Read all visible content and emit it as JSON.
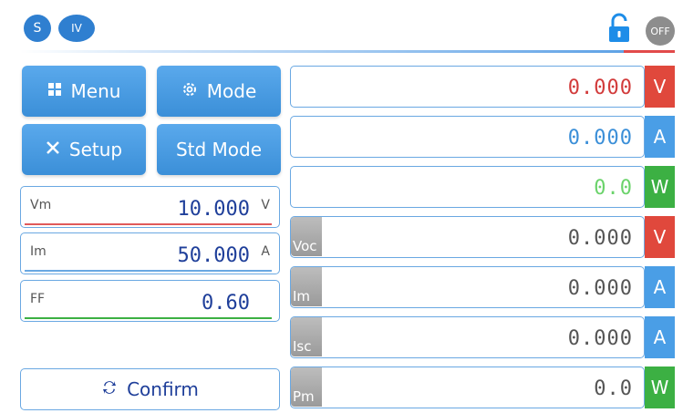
{
  "topbar": {
    "badge_s": "S",
    "badge_iv": "IV",
    "power_state": "OFF",
    "lock_icon": "unlock-icon"
  },
  "buttons": {
    "menu": "Menu",
    "mode": "Mode",
    "setup": "Setup",
    "std_mode": "Std Mode",
    "confirm": "Confirm"
  },
  "params": [
    {
      "label": "Vm",
      "value": "10.000",
      "unit": "V"
    },
    {
      "label": "Im",
      "value": "50.000",
      "unit": "A"
    },
    {
      "label": "FF",
      "value": "0.60",
      "unit": ""
    }
  ],
  "readings": [
    {
      "tag": "",
      "value": "0.000",
      "unit": "V",
      "value_color": "#d23b3b",
      "unit_color": "#e0483c"
    },
    {
      "tag": "",
      "value": "0.000",
      "unit": "A",
      "value_color": "#3b8fd8",
      "unit_color": "#4a9ee6"
    },
    {
      "tag": "",
      "value": "0.0",
      "unit": "W",
      "value_color": "#6bd36b",
      "unit_color": "#3cb043"
    },
    {
      "tag": "Voc",
      "value": "0.000",
      "unit": "V",
      "value_color": "#555555",
      "unit_color": "#e0483c"
    },
    {
      "tag": "Im",
      "value": "0.000",
      "unit": "A",
      "value_color": "#555555",
      "unit_color": "#4a9ee6"
    },
    {
      "tag": "Isc",
      "value": "0.000",
      "unit": "A",
      "value_color": "#555555",
      "unit_color": "#4a9ee6"
    },
    {
      "tag": "Pm",
      "value": "0.0",
      "unit": "W",
      "value_color": "#555555",
      "unit_color": "#3cb043"
    }
  ],
  "colors": {
    "accent": "#3b8fd8",
    "red": "#e0483c",
    "green": "#3cb043"
  }
}
